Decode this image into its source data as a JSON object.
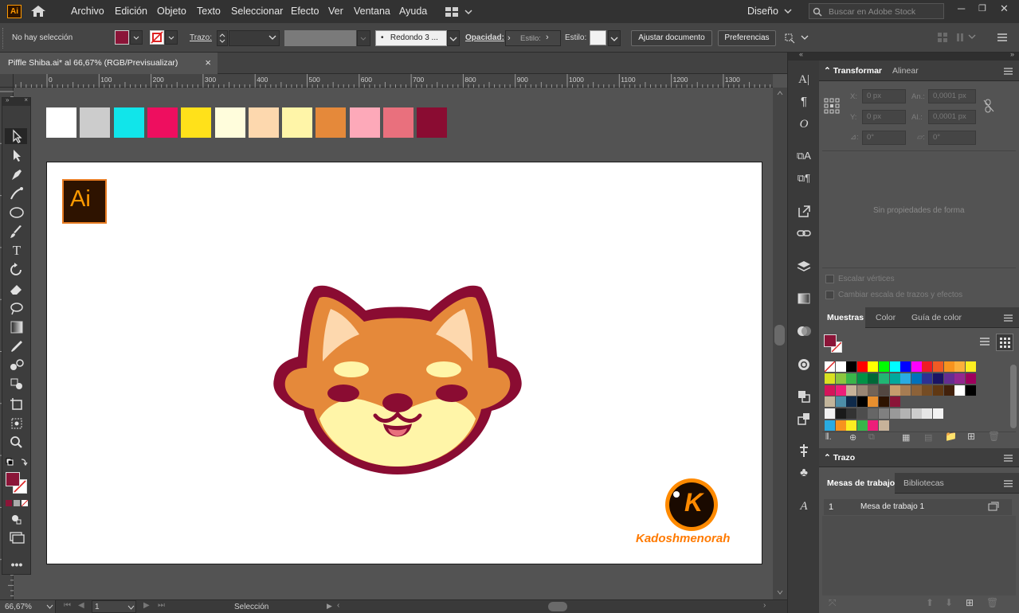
{
  "app": {
    "logo": "Ai"
  },
  "menu": [
    "Archivo",
    "Edición",
    "Objeto",
    "Texto",
    "Seleccionar",
    "Efecto",
    "Ver",
    "Ventana",
    "Ayuda"
  ],
  "workspace": {
    "label": "Diseño"
  },
  "search": {
    "placeholder": "Buscar en Adobe Stock"
  },
  "control": {
    "selection": "No hay selección",
    "stroke_label": "Trazo:",
    "brush": "Redondo 3 ...",
    "opacity_label": "Opacidad:",
    "style_label": "Estilo:",
    "style_label2": "Estilo:",
    "fit_button": "Ajustar documento",
    "prefs_button": "Preferencias",
    "fill_color": "#8b1538"
  },
  "document": {
    "tab_title": "Piffle Shiba.ai* al 66,67% (RGB/Previsualizar)",
    "close": "×"
  },
  "ruler": {
    "labels": [
      "0",
      "100",
      "200",
      "300",
      "400",
      "500",
      "600",
      "700",
      "800",
      "900",
      "1000",
      "1100",
      "1200",
      "1300"
    ]
  },
  "palette": [
    "#ffffff",
    "#cccccc",
    "#11e5ea",
    "#ee0e5f",
    "#ffe11a",
    "#fffddc",
    "#fdd8ae",
    "#fff5a8",
    "#e5893a",
    "#fda9b9",
    "#e9707d",
    "#8a0c32"
  ],
  "artboard": {
    "badge": "Ai",
    "watermark": "Kadoshmenorah",
    "watermark_letter": "K"
  },
  "status": {
    "zoom": "66,67%",
    "page": "1",
    "tool": "Selección"
  },
  "transform_panel": {
    "tabs": [
      "Transformar",
      "Alinear"
    ],
    "x_label": "X:",
    "x_value": "0 px",
    "y_label": "Y:",
    "y_value": "0 px",
    "w_label": "An.:",
    "w_value": "0,0001 px",
    "h_label": "Al.:",
    "h_value": "0,0001 px",
    "angle_value": "0°",
    "shear_value": "0°",
    "empty_text": "Sin propiedades de forma",
    "scale_corners": "Escalar vértices",
    "scale_strokes": "Cambiar escala de trazos y efectos"
  },
  "swatches_panel": {
    "tabs": [
      "Muestras",
      "Color",
      "Guía de color"
    ],
    "rows": [
      [
        "#ffffff",
        "#ffffff",
        "#000000",
        "#ff0000",
        "#ffff00",
        "#00ff00",
        "#00ffff",
        "#0000ff",
        "#ff00ff",
        "#ee1c25",
        "#f15a24",
        "#f7931e",
        "#fbb03b",
        "#fcee21"
      ],
      [
        "#d9e021",
        "#8cc63f",
        "#39b54a",
        "#009245",
        "#006837",
        "#22b573",
        "#00a99d",
        "#29abe2",
        "#0071bc",
        "#2e3192",
        "#1b1464",
        "#662d91",
        "#93278f",
        "#9e005d"
      ],
      [
        "#d4145a",
        "#ed1e79",
        "#c7b299",
        "#998675",
        "#736357",
        "#534741",
        "#c69c6d",
        "#a67c52",
        "#8c6239",
        "#754c24",
        "#603813",
        "#42210b",
        "#ffffff",
        "#000000"
      ],
      [
        "#c2b59b",
        "#4d8ea8",
        "#0f2a4a",
        "#000000",
        "#e88f2f",
        "#2d1300",
        "#8b1538"
      ],
      [
        "#f2f2f2",
        "#1a1a1a",
        "#333333",
        "#4d4d4d",
        "#666666",
        "#808080",
        "#999999",
        "#b3b3b3",
        "#cccccc",
        "#e6e6e6",
        "#f2f2f2"
      ],
      [
        "#29abe2",
        "#f7931e",
        "#fcee21",
        "#39b54a",
        "#ed1e79",
        "#c7b299"
      ]
    ]
  },
  "stroke_panel": {
    "title": "Trazo"
  },
  "artboards_panel": {
    "tabs": [
      "Mesas de trabajo",
      "Bibliotecas"
    ],
    "row_index": "1",
    "row_name": "Mesa de trabajo 1"
  }
}
